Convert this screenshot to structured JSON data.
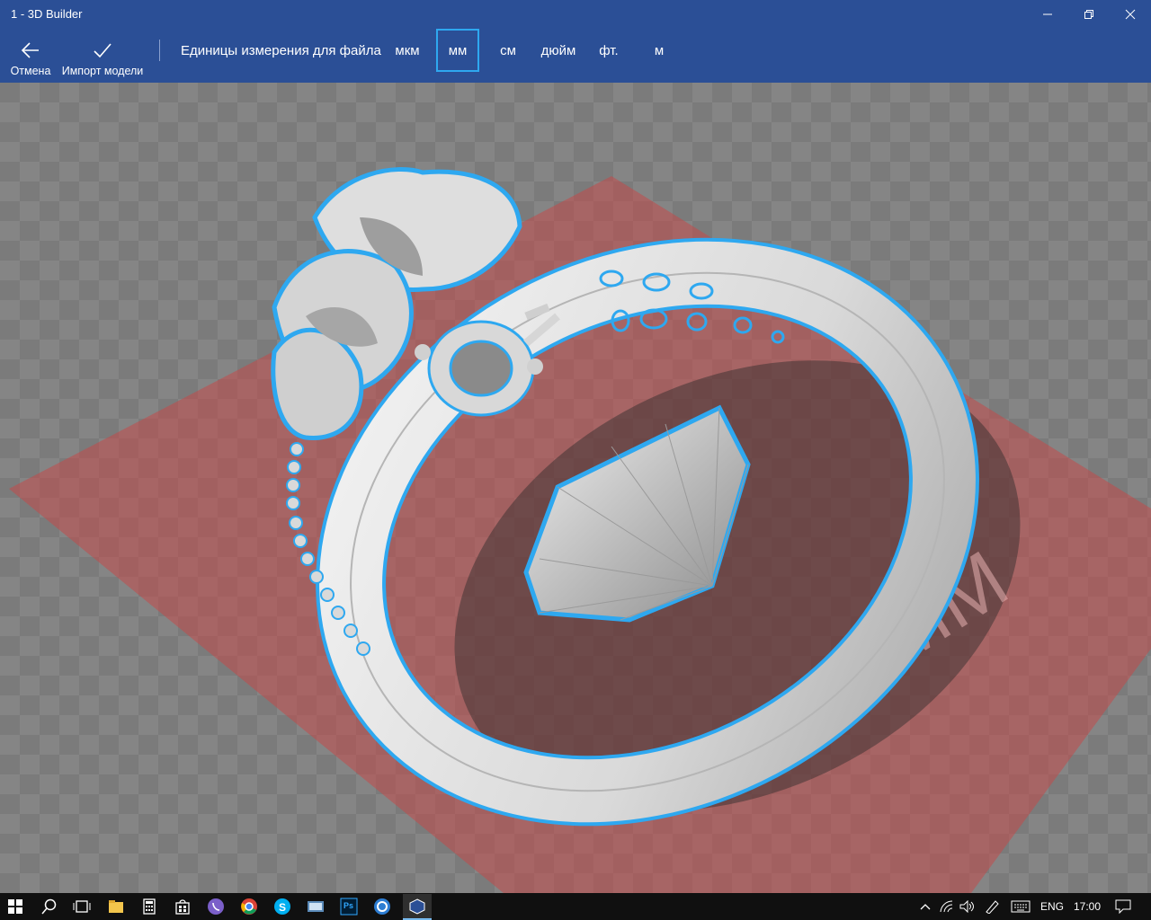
{
  "window": {
    "title": "1 - 3D Builder"
  },
  "toolbar": {
    "cancel_label": "Отмена",
    "import_label": "Импорт модели",
    "units_label": "Единицы измерения для файла",
    "units": [
      "мкм",
      "мм",
      "см",
      "дюйм",
      "фт.",
      "м"
    ],
    "selected_unit": "мм"
  },
  "scene": {
    "bed_label": "MM",
    "colors": {
      "selection_outline": "#2ea8f0",
      "bed": "#c24a4a",
      "model": "#e6e6e6",
      "ui_bar": "#2b4f96"
    }
  },
  "taskbar": {
    "icons": [
      "windows-start-icon",
      "search-icon",
      "task-view-icon",
      "file-explorer-icon",
      "calculator-icon",
      "store-icon",
      "viber-icon",
      "chrome-icon",
      "skype-icon",
      "network-app-icon",
      "photoshop-icon",
      "app-icon",
      "3d-builder-icon"
    ],
    "photoshop_label": "Ps",
    "language": "ENG",
    "time": "17:00"
  }
}
